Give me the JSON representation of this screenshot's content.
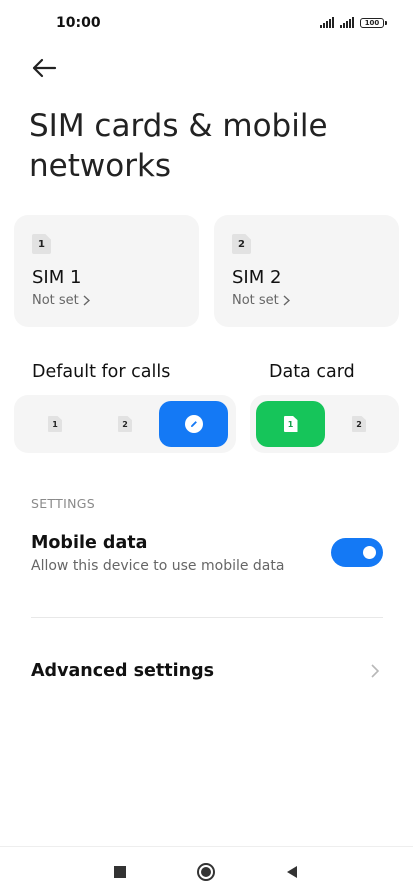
{
  "status_bar": {
    "time": "10:00",
    "battery": "100",
    "icons": [
      "signal-icon",
      "signal-icon",
      "battery-icon"
    ]
  },
  "header": {
    "back_icon": "back-arrow-icon",
    "title": "SIM cards & mobile networks"
  },
  "sim_cards": [
    {
      "badge": "1",
      "name": "SIM 1",
      "status": "Not set"
    },
    {
      "badge": "2",
      "name": "SIM 2",
      "status": "Not set"
    }
  ],
  "default_calls": {
    "label": "Default for calls",
    "options": [
      "1",
      "2"
    ],
    "active_icon": "edit-icon"
  },
  "data_card": {
    "label": "Data card",
    "options": [
      "1",
      "2"
    ],
    "selected": "1"
  },
  "settings": {
    "section_header": "SETTINGS",
    "mobile_data_title": "Mobile data",
    "mobile_data_subtitle": "Allow this device to use mobile data",
    "mobile_data_enabled": true,
    "advanced_label": "Advanced settings"
  },
  "nav_bar": {
    "icons": [
      "recents-square-icon",
      "home-circle-icon",
      "back-triangle-icon"
    ]
  },
  "colors": {
    "accent_blue": "#1479f5",
    "accent_green": "#16c55a",
    "card_bg": "#f5f5f5"
  }
}
